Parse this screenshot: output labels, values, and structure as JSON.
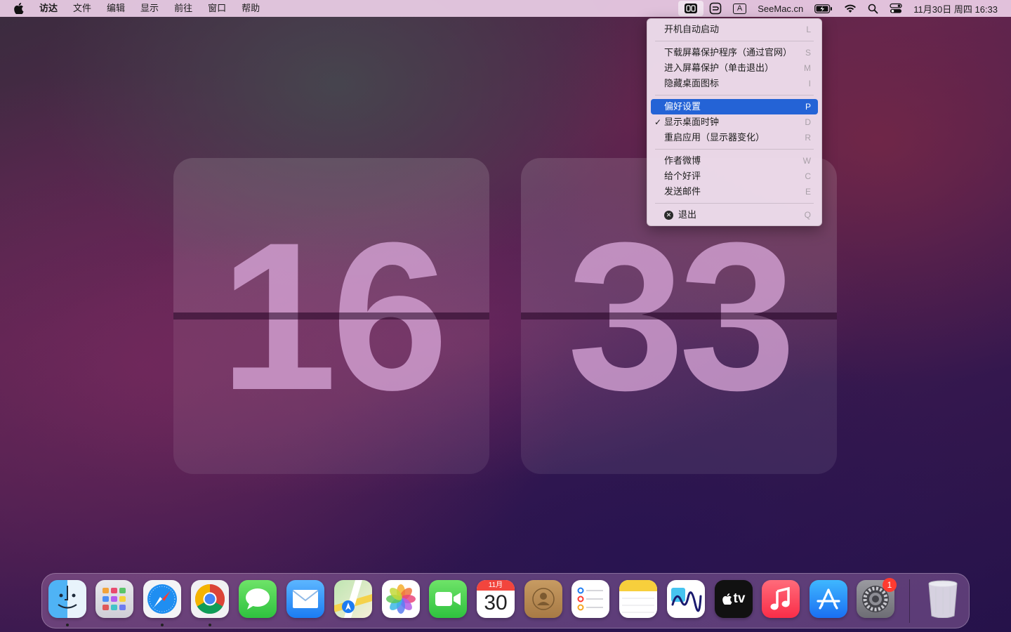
{
  "menubar": {
    "app_name": "访达",
    "menus": [
      "文件",
      "编辑",
      "显示",
      "前往",
      "窗口",
      "帮助"
    ],
    "status_site": "SeeMac.cn",
    "input_method": "A",
    "datetime": "11月30日 周四  16:33"
  },
  "clock": {
    "hours": "16",
    "minutes": "33"
  },
  "dropdown": {
    "items": [
      {
        "label": "开机自动启动",
        "shortcut": "L"
      },
      {
        "label": "下载屏幕保护程序（通过官网）",
        "shortcut": "S"
      },
      {
        "label": "进入屏幕保护（单击退出）",
        "shortcut": "M"
      },
      {
        "label": "隐藏桌面图标",
        "shortcut": "I"
      },
      {
        "label": "偏好设置",
        "shortcut": "P"
      },
      {
        "label": "显示桌面时钟",
        "shortcut": "D"
      },
      {
        "label": "重启应用（显示器变化）",
        "shortcut": "R"
      },
      {
        "label": "作者微博",
        "shortcut": "W"
      },
      {
        "label": "给个好评",
        "shortcut": "C"
      },
      {
        "label": "发送邮件",
        "shortcut": "E"
      },
      {
        "label": "退出",
        "shortcut": "Q"
      }
    ],
    "checkmark": "✓"
  },
  "dock": {
    "calendar_month": "11月",
    "calendar_day": "30",
    "settings_badge": "1",
    "apps": [
      "finder-icon",
      "launchpad-icon",
      "safari-icon",
      "chrome-icon",
      "messages-icon",
      "mail-icon",
      "maps-icon",
      "photos-icon",
      "facetime-icon",
      "calendar-icon",
      "contacts-icon",
      "reminders-icon",
      "notes-icon",
      "freeform-icon",
      "apple-tv-icon",
      "music-icon",
      "app-store-icon",
      "system-settings-icon",
      "trash-icon"
    ],
    "tv_label": "tv"
  }
}
